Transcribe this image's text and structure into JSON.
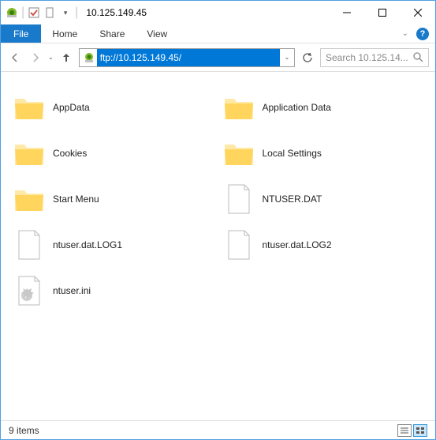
{
  "window": {
    "title": "10.125.149.45"
  },
  "ribbon": {
    "file": "File",
    "home": "Home",
    "share": "Share",
    "view": "View"
  },
  "address": {
    "url": "ftp://10.125.149.45/"
  },
  "search": {
    "placeholder": "Search 10.125.14..."
  },
  "items": [
    {
      "name": "AppData",
      "type": "folder"
    },
    {
      "name": "Application Data",
      "type": "folder"
    },
    {
      "name": "Cookies",
      "type": "folder"
    },
    {
      "name": "Local Settings",
      "type": "folder"
    },
    {
      "name": "Start Menu",
      "type": "folder"
    },
    {
      "name": "NTUSER.DAT",
      "type": "file"
    },
    {
      "name": "ntuser.dat.LOG1",
      "type": "file"
    },
    {
      "name": "ntuser.dat.LOG2",
      "type": "file"
    },
    {
      "name": "ntuser.ini",
      "type": "ini"
    }
  ],
  "status": {
    "count": "9 items"
  },
  "icons": {
    "folder_svg": "folder",
    "file_svg": "file",
    "ini_svg": "ini"
  }
}
